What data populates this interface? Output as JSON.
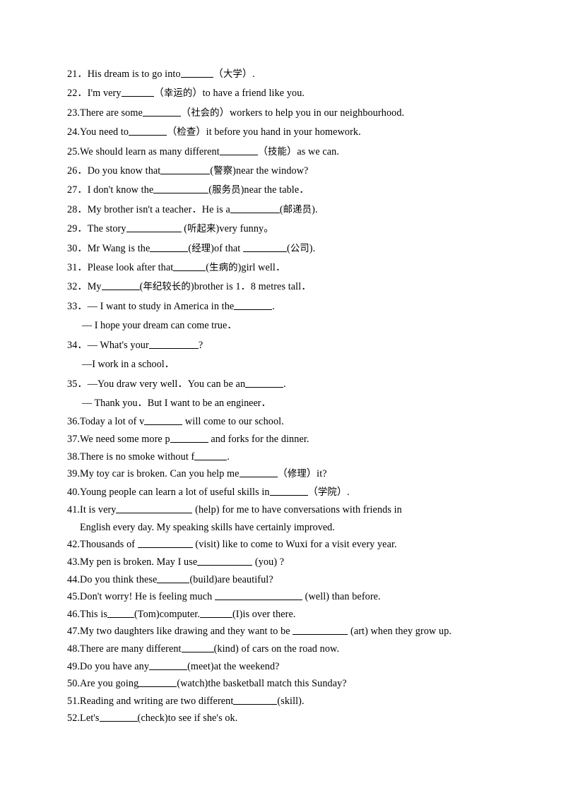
{
  "document": {
    "type": "english-fill-in-the-blank-worksheet",
    "language_note": "English exercise sentences with Chinese hints in parentheses",
    "page_background": "#ffffff",
    "text_color": "#000000"
  },
  "questions": [
    {
      "number": "21．",
      "parts": [
        {
          "t": "text",
          "v": "His dream is to go into"
        },
        {
          "t": "blank",
          "w": "b6"
        },
        {
          "t": "text",
          "v": "（"
        },
        {
          "t": "cn",
          "v": "大学"
        },
        {
          "t": "text",
          "v": "）."
        }
      ],
      "plain": "21． His dream is to go into______（大学）."
    },
    {
      "number": "22．",
      "parts": [
        {
          "t": "text",
          "v": "I'm very"
        },
        {
          "t": "blank",
          "w": "b6"
        },
        {
          "t": "text",
          "v": "（"
        },
        {
          "t": "cn",
          "v": "幸运的"
        },
        {
          "t": "text",
          "v": "）to have a friend like you."
        }
      ],
      "plain": "22． I'm very______（幸运的）to have a friend like you."
    },
    {
      "number": "23.",
      "parts": [
        {
          "t": "text",
          "v": "There are some"
        },
        {
          "t": "blank",
          "w": "b7"
        },
        {
          "t": "text",
          "v": "（"
        },
        {
          "t": "cn",
          "v": "社会的"
        },
        {
          "t": "text",
          "v": "）workers to help you in our neighbourhood."
        }
      ],
      "plain": "23. There are some_______（社会的）workers to help you in our neighbourhood."
    },
    {
      "number": "24.",
      "parts": [
        {
          "t": "text",
          "v": "You need to"
        },
        {
          "t": "blank",
          "w": "b7"
        },
        {
          "t": "text",
          "v": "（"
        },
        {
          "t": "cn",
          "v": "检查"
        },
        {
          "t": "text",
          "v": "）it before you hand in your homework."
        }
      ],
      "plain": "24. You need to_______（检查）it before you hand in your homework."
    },
    {
      "number": "25.",
      "parts": [
        {
          "t": "text",
          "v": "We should learn as many different"
        },
        {
          "t": "blank",
          "w": "b7"
        },
        {
          "t": "text",
          "v": "（"
        },
        {
          "t": "cn",
          "v": "技能"
        },
        {
          "t": "text",
          "v": "）as we can."
        }
      ],
      "plain": "25. We should learn as many different_______（技能）as we can."
    },
    {
      "number": "26．",
      "parts": [
        {
          "t": "text",
          "v": "Do you know that"
        },
        {
          "t": "blank",
          "w": "b9"
        },
        {
          "t": "text",
          "v": "("
        },
        {
          "t": "cn",
          "v": "警察"
        },
        {
          "t": "text",
          "v": ")near the window?"
        }
      ],
      "plain": "26． Do you know that_________(警察)near the window?"
    },
    {
      "number": "27．",
      "parts": [
        {
          "t": "text",
          "v": "I don't know the"
        },
        {
          "t": "blank",
          "w": "b10"
        },
        {
          "t": "text",
          "v": "("
        },
        {
          "t": "cn",
          "v": "服务员"
        },
        {
          "t": "text",
          "v": ")near the table．"
        }
      ],
      "plain": "27． I don't know the__________(服务员)near the table．"
    },
    {
      "number": "28．",
      "parts": [
        {
          "t": "text",
          "v": "My brother isn't a teacher．He is a"
        },
        {
          "t": "blank",
          "w": "b9"
        },
        {
          "t": "text",
          "v": "("
        },
        {
          "t": "cn",
          "v": "邮递员"
        },
        {
          "t": "text",
          "v": ")."
        }
      ],
      "plain": "28． My brother isn't a teacher．He is a_________(邮递员)."
    },
    {
      "number": "29．",
      "parts": [
        {
          "t": "text",
          "v": "The story"
        },
        {
          "t": "blank",
          "w": "b10"
        },
        {
          "t": "text",
          "v": " ("
        },
        {
          "t": "cn",
          "v": "听起来"
        },
        {
          "t": "text",
          "v": ")very funny。"
        }
      ],
      "plain": "29． The story__________ (听起来)very funny。"
    },
    {
      "number": "30．",
      "parts": [
        {
          "t": "text",
          "v": "Mr Wang is the"
        },
        {
          "t": "blank",
          "w": "b7"
        },
        {
          "t": "text",
          "v": "("
        },
        {
          "t": "cn",
          "v": "经理"
        },
        {
          "t": "text",
          "v": ")of that "
        },
        {
          "t": "blank",
          "w": "b8"
        },
        {
          "t": "text",
          "v": "("
        },
        {
          "t": "cn",
          "v": "公司"
        },
        {
          "t": "text",
          "v": ")."
        }
      ],
      "plain": "30． Mr Wang is the_______(经理)of that ________(公司)."
    },
    {
      "number": "31．",
      "parts": [
        {
          "t": "text",
          "v": "Please look after that"
        },
        {
          "t": "blank",
          "w": "b6"
        },
        {
          "t": "text",
          "v": "("
        },
        {
          "t": "cn",
          "v": "生病的"
        },
        {
          "t": "text",
          "v": ")girl well．"
        }
      ],
      "plain": "31． Please look after that______(生病的)girl well．"
    },
    {
      "number": "32．",
      "parts": [
        {
          "t": "text",
          "v": "My"
        },
        {
          "t": "blank",
          "w": "b7"
        },
        {
          "t": "text",
          "v": "("
        },
        {
          "t": "cn",
          "v": "年纪较长的"
        },
        {
          "t": "text",
          "v": ")brother is 1．8 metres tall．"
        }
      ],
      "plain": "32． My_______(年纪较长的)brother is 1．8 metres tall．"
    },
    {
      "number": "33．",
      "parts": [
        {
          "t": "text",
          "v": "— I want to study in America in the"
        },
        {
          "t": "blank",
          "w": "b7"
        },
        {
          "t": "text",
          "v": "."
        }
      ],
      "plain": "33． — I want to study in America in the_______.",
      "continuation": "— I hope your dream can come true．"
    },
    {
      "number": "34．",
      "parts": [
        {
          "t": "text",
          "v": "— What's your"
        },
        {
          "t": "blank",
          "w": "b9"
        },
        {
          "t": "text",
          "v": "?"
        }
      ],
      "plain": "34． — What's your_________?",
      "continuation": "—I work in a school．"
    },
    {
      "number": "35．",
      "parts": [
        {
          "t": "text",
          "v": "—You draw very well．You can be an"
        },
        {
          "t": "blank",
          "w": "b7"
        },
        {
          "t": "text",
          "v": "."
        }
      ],
      "plain": "35． —You draw very well．You can be an_______.",
      "continuation": "— Thank you．But I want to be an engineer．"
    },
    {
      "number": "36.",
      "parts": [
        {
          "t": "text",
          "v": "Today a lot of v"
        },
        {
          "t": "blank",
          "w": "b7"
        },
        {
          "t": "text",
          "v": " will come to our school."
        }
      ],
      "plain": "36. Today a lot of v_______ will come to our school."
    },
    {
      "number": "37.",
      "parts": [
        {
          "t": "text",
          "v": "We need some more p"
        },
        {
          "t": "blank",
          "w": "b7"
        },
        {
          "t": "text",
          "v": " and forks for the dinner."
        }
      ],
      "plain": "37. We need some more p_______ and forks for the dinner."
    },
    {
      "number": "38.",
      "parts": [
        {
          "t": "text",
          "v": "There is no smoke without f"
        },
        {
          "t": "blank",
          "w": "b6"
        },
        {
          "t": "text",
          "v": "."
        }
      ],
      "plain": "38. There is no smoke without f______."
    },
    {
      "number": "39.",
      "parts": [
        {
          "t": "text",
          "v": "My toy car is broken. Can you help me"
        },
        {
          "t": "blank",
          "w": "b7"
        },
        {
          "t": "text",
          "v": "（"
        },
        {
          "t": "cn",
          "v": "修理"
        },
        {
          "t": "text",
          "v": "）it?"
        }
      ],
      "plain": "39. My toy car is broken. Can you help me_______（修理）it?"
    },
    {
      "number": "40.",
      "parts": [
        {
          "t": "text",
          "v": "Young people can learn a lot of useful skills in"
        },
        {
          "t": "blank",
          "w": "b7"
        },
        {
          "t": "text",
          "v": "（"
        },
        {
          "t": "cn",
          "v": "学院"
        },
        {
          "t": "text",
          "v": "）."
        }
      ],
      "plain": "40. Young people can learn a lot of useful skills in_______（学院）."
    },
    {
      "number": "41.",
      "parts": [
        {
          "t": "text",
          "v": "It is very"
        },
        {
          "t": "blank",
          "w": "b14"
        },
        {
          "t": "text",
          "v": " (help) for me to have conversations with friends in"
        }
      ],
      "plain": "41. It is very______________ (help) for me to have conversations with friends in",
      "continuation": "English every day. My speaking skills have certainly improved."
    },
    {
      "number": "42.",
      "parts": [
        {
          "t": "text",
          "v": "Thousands of  "
        },
        {
          "t": "blank",
          "w": "b10"
        },
        {
          "t": "text",
          "v": " (visit) like to come to Wuxi for a visit every year."
        }
      ],
      "plain": "42. Thousands of  __________ (visit) like to come to Wuxi for a visit every year."
    },
    {
      "number": "43.",
      "parts": [
        {
          "t": "text",
          "v": "My pen is broken. May I use"
        },
        {
          "t": "blank",
          "w": "b10"
        },
        {
          "t": "text",
          "v": " (you) ?"
        }
      ],
      "plain": "43.My pen is broken. May I use__________ (you) ?"
    },
    {
      "number": "44.",
      "parts": [
        {
          "t": "text",
          "v": "Do you think these"
        },
        {
          "t": "blank",
          "w": "b6"
        },
        {
          "t": "text",
          "v": "(build)are beautiful?"
        }
      ],
      "plain": "44. Do you think these______(build)are beautiful?"
    },
    {
      "number": "45.",
      "parts": [
        {
          "t": "text",
          "v": "Don't worry! He is feeling much "
        },
        {
          "t": "blank",
          "w": "b16"
        },
        {
          "t": "text",
          "v": " (well) than before."
        }
      ],
      "plain": "45. Don't worry! He is feeling much ________________ (well) than before."
    },
    {
      "number": "46.",
      "parts": [
        {
          "t": "text",
          "v": "This is"
        },
        {
          "t": "blank",
          "w": "b5"
        },
        {
          "t": "text",
          "v": "(Tom)computer."
        },
        {
          "t": "blank",
          "w": "b6"
        },
        {
          "t": "text",
          "v": "(I)is over there."
        }
      ],
      "plain": "46. This is_____(Tom)computer.______(I)is over there."
    },
    {
      "number": "47.",
      "parts": [
        {
          "t": "text",
          "v": "My two daughters like drawing and they want to be "
        },
        {
          "t": "blank",
          "w": "b10"
        },
        {
          "t": "text",
          "v": " (art) when they grow up."
        }
      ],
      "plain": "47. My two daughters like drawing and they want to be __________ (art) when they grow up."
    },
    {
      "number": "48.",
      "parts": [
        {
          "t": "text",
          "v": "There are many different"
        },
        {
          "t": "blank",
          "w": "b6"
        },
        {
          "t": "text",
          "v": "(kind) of cars on the road now."
        }
      ],
      "plain": "48. There are many different______(kind) of cars on the road now."
    },
    {
      "number": "49.",
      "parts": [
        {
          "t": "text",
          "v": "Do you have any"
        },
        {
          "t": "blank",
          "w": "b7"
        },
        {
          "t": "text",
          "v": "(meet)at the weekend?"
        }
      ],
      "plain": "49. Do you have any_______(meet)at the weekend?"
    },
    {
      "number": "50.",
      "parts": [
        {
          "t": "text",
          "v": "Are you going"
        },
        {
          "t": "blank",
          "w": "b7"
        },
        {
          "t": "text",
          "v": "(watch)the basketball match this Sunday?"
        }
      ],
      "plain": "50. Are you going_______(watch)the basketball match this Sunday?"
    },
    {
      "number": "51.",
      "parts": [
        {
          "t": "text",
          "v": "Reading and writing are two different"
        },
        {
          "t": "blank",
          "w": "b8"
        },
        {
          "t": "text",
          "v": "(skill)."
        }
      ],
      "plain": "51. Reading and writing are two different________(skill)."
    },
    {
      "number": "52.",
      "parts": [
        {
          "t": "text",
          "v": "Let's"
        },
        {
          "t": "blank",
          "w": "b7"
        },
        {
          "t": "text",
          "v": "(check)to see if she's ok."
        }
      ],
      "plain": "52. Let's_______(check)to see if she's ok."
    }
  ]
}
